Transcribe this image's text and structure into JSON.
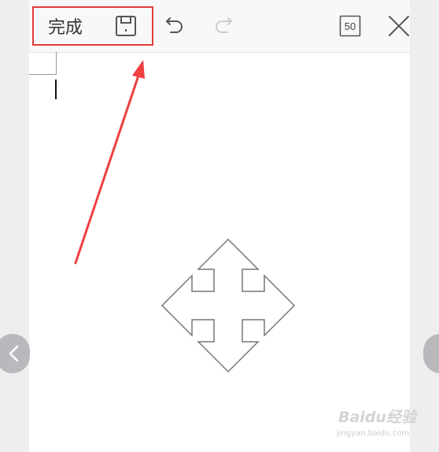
{
  "toolbar": {
    "done_label": "完成",
    "save_icon": "save-icon",
    "undo_icon": "undo-icon",
    "redo_icon": "redo-icon",
    "page_badge": "50",
    "close_icon": "close-icon"
  },
  "watermark": {
    "brand": "Baidu经验",
    "url": "jingyan.baidu.com"
  },
  "colors": {
    "highlight": "#e43b3b",
    "arrow": "#f04040",
    "toolbar_bg": "#f8f8f8",
    "icon_dark": "#555555",
    "icon_disabled": "#cccccc"
  }
}
